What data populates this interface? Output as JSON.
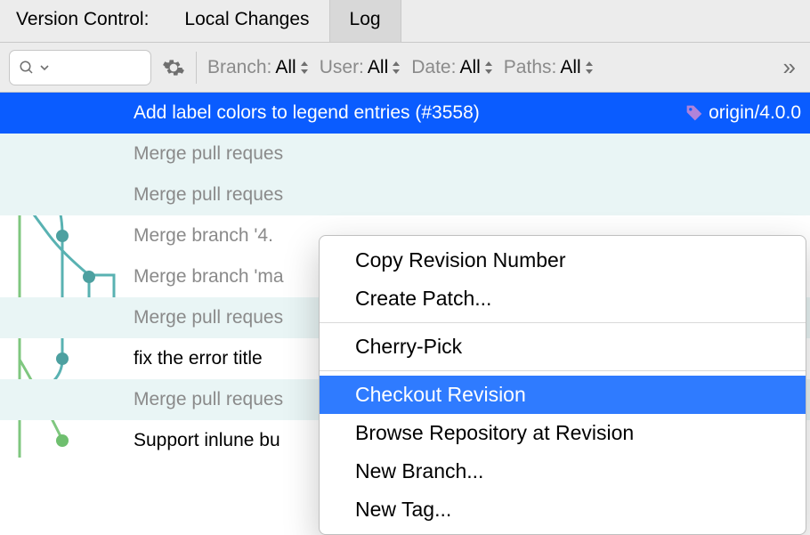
{
  "header": {
    "title": "Version Control:"
  },
  "tabs": {
    "local": "Local Changes",
    "log": "Log"
  },
  "filters": {
    "branch_label": "Branch:",
    "branch_value": "All",
    "user_label": "User:",
    "user_value": "All",
    "date_label": "Date:",
    "date_value": "All",
    "paths_label": "Paths:",
    "paths_value": "All"
  },
  "commits": [
    {
      "msg": "Add label colors to legend entries (#3558)",
      "tag": "origin/4.0.0"
    },
    {
      "msg": "Merge pull reques"
    },
    {
      "msg": "Merge pull reques"
    },
    {
      "msg": "Merge branch '4."
    },
    {
      "msg": "Merge branch 'ma"
    },
    {
      "msg": "Merge pull reques"
    },
    {
      "msg": "fix the error title "
    },
    {
      "msg": "Merge pull reques"
    },
    {
      "msg": "Support inlune bu"
    }
  ],
  "menu": {
    "copy": "Copy Revision Number",
    "patch": "Create Patch...",
    "cherry": "Cherry-Pick",
    "checkout": "Checkout Revision",
    "browse": "Browse Repository at Revision",
    "newbranch": "New Branch...",
    "newtag": "New Tag..."
  }
}
